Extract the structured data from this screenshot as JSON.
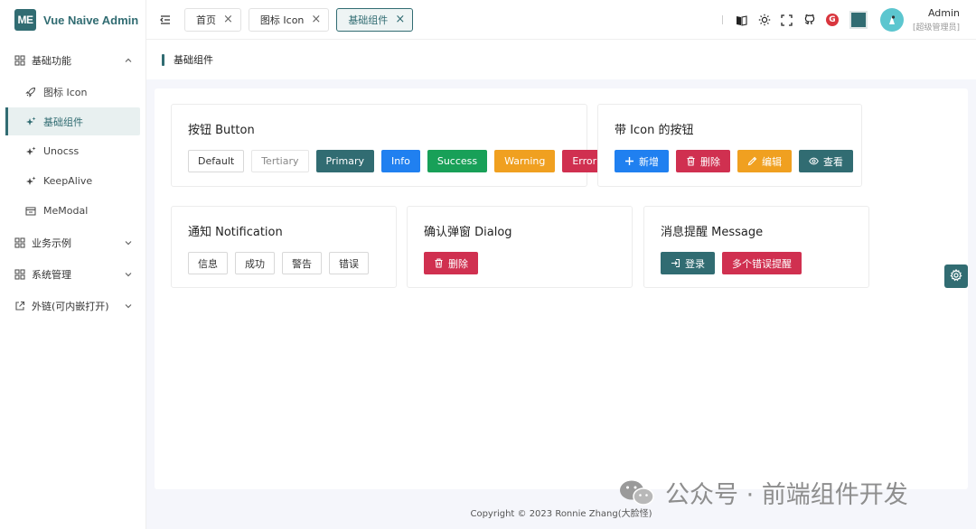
{
  "brand": {
    "logo_text": "ME",
    "title": "Vue Naive Admin"
  },
  "sidebar": {
    "groups": [
      {
        "label": "基础功能",
        "expanded": true,
        "items": [
          {
            "label": "图标 Icon",
            "icon": "rocket-icon"
          },
          {
            "label": "基础组件",
            "icon": "sparkle-icon",
            "active": true
          },
          {
            "label": "Unocss",
            "icon": "sparkle-icon"
          },
          {
            "label": "KeepAlive",
            "icon": "sparkle-icon"
          },
          {
            "label": "MeModal",
            "icon": "window-icon"
          }
        ]
      },
      {
        "label": "业务示例",
        "expanded": false
      },
      {
        "label": "系统管理",
        "expanded": false
      },
      {
        "label": "外链(可内嵌打开)",
        "expanded": false
      }
    ]
  },
  "header": {
    "tabs": [
      {
        "label": "首页"
      },
      {
        "label": "图标 Icon"
      },
      {
        "label": "基础组件",
        "active": true
      }
    ],
    "user": {
      "name": "Admin",
      "role": "[超级管理员]"
    },
    "theme_color": "#316c72",
    "badge_text": "G"
  },
  "breadcrumb": {
    "title": "基础组件"
  },
  "cards": {
    "button": {
      "title": "按钮 Button",
      "buttons": [
        "Default",
        "Tertiary",
        "Primary",
        "Info",
        "Success",
        "Warning",
        "Error"
      ]
    },
    "icon_button": {
      "title": "带 Icon 的按钮",
      "buttons": [
        "新增",
        "删除",
        "编辑",
        "查看"
      ]
    },
    "notification": {
      "title": "通知 Notification",
      "buttons": [
        "信息",
        "成功",
        "警告",
        "错误"
      ]
    },
    "dialog": {
      "title": "确认弹窗 Dialog",
      "buttons": [
        "删除"
      ]
    },
    "message": {
      "title": "消息提醒 Message",
      "buttons": [
        "登录",
        "多个错误提醒"
      ]
    }
  },
  "footer": {
    "text": "Copyright © 2023 Ronnie Zhang(大脸怪)"
  },
  "watermark": {
    "text": "公众号 · 前端组件开发"
  },
  "colors": {
    "primary": "#316c72",
    "info": "#2080f0",
    "success": "#18a058",
    "warning": "#f0a020",
    "error": "#d03050"
  }
}
